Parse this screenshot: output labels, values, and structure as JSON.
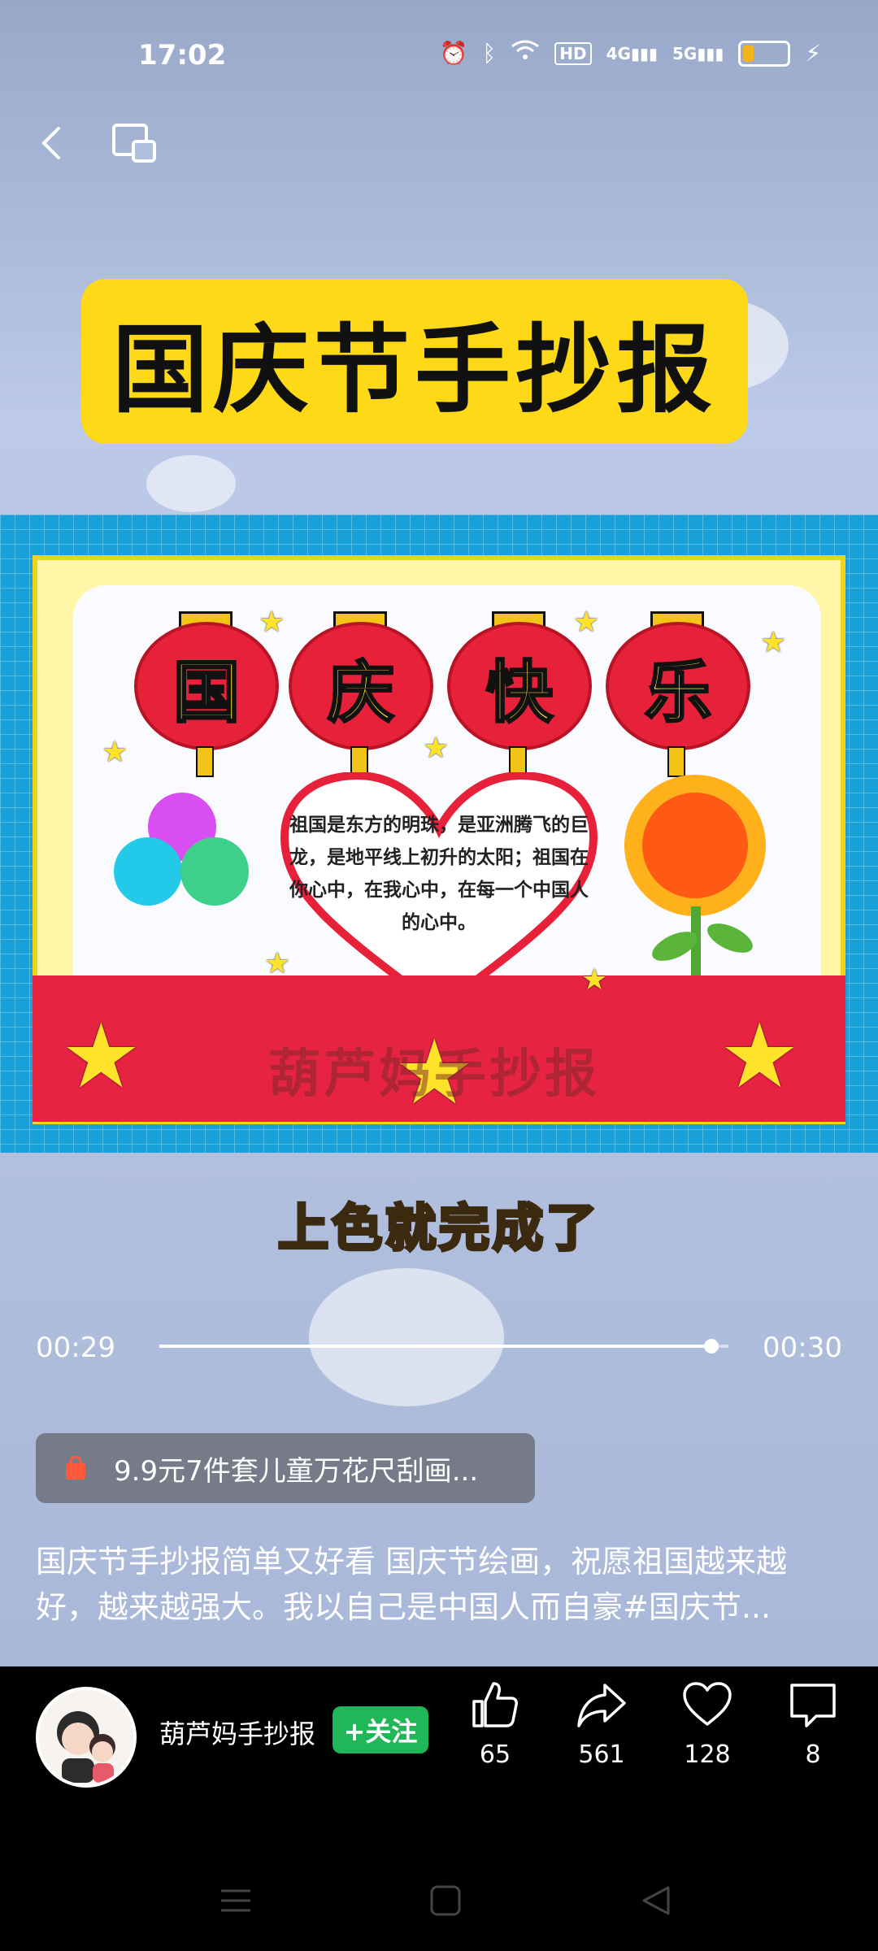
{
  "status_bar": {
    "time": "17:02",
    "hd_badge": "HD",
    "net1": "4G",
    "net2": "5G",
    "battery_level": 0.25
  },
  "video": {
    "title_banner": "国庆节手抄报",
    "artwork": {
      "lanterns": [
        "国",
        "庆",
        "快",
        "乐"
      ],
      "heart_text": "祖国是东方的明珠，是亚洲腾飞的巨龙，是地平线上初升的太阳；祖国在你心中，在我心中，在每一个中国人的心中。",
      "watermark": "葫芦妈手抄报"
    },
    "caption": "上色就完成了",
    "current_time": "00:29",
    "total_time": "00:30",
    "progress": 0.97
  },
  "product": {
    "label": "9.9元7件套儿童万花尺刮画..."
  },
  "description": "国庆节手抄报简单又好看 国庆节绘画，祝愿祖国越来越好，越来越强大。我以自己是中国人而自豪#国庆节...",
  "author": {
    "name": "葫芦妈手抄报",
    "follow_label": "+关注"
  },
  "actions": {
    "like": {
      "icon": "thumbs-up-icon",
      "count": "65"
    },
    "share": {
      "icon": "share-icon",
      "count": "561"
    },
    "favorite": {
      "icon": "heart-icon",
      "count": "128"
    },
    "comment": {
      "icon": "comment-icon",
      "count": "8"
    }
  },
  "colors": {
    "banner_yellow": "#fdd917",
    "follow_green": "#1fb757",
    "lantern_red": "#e8213a"
  }
}
